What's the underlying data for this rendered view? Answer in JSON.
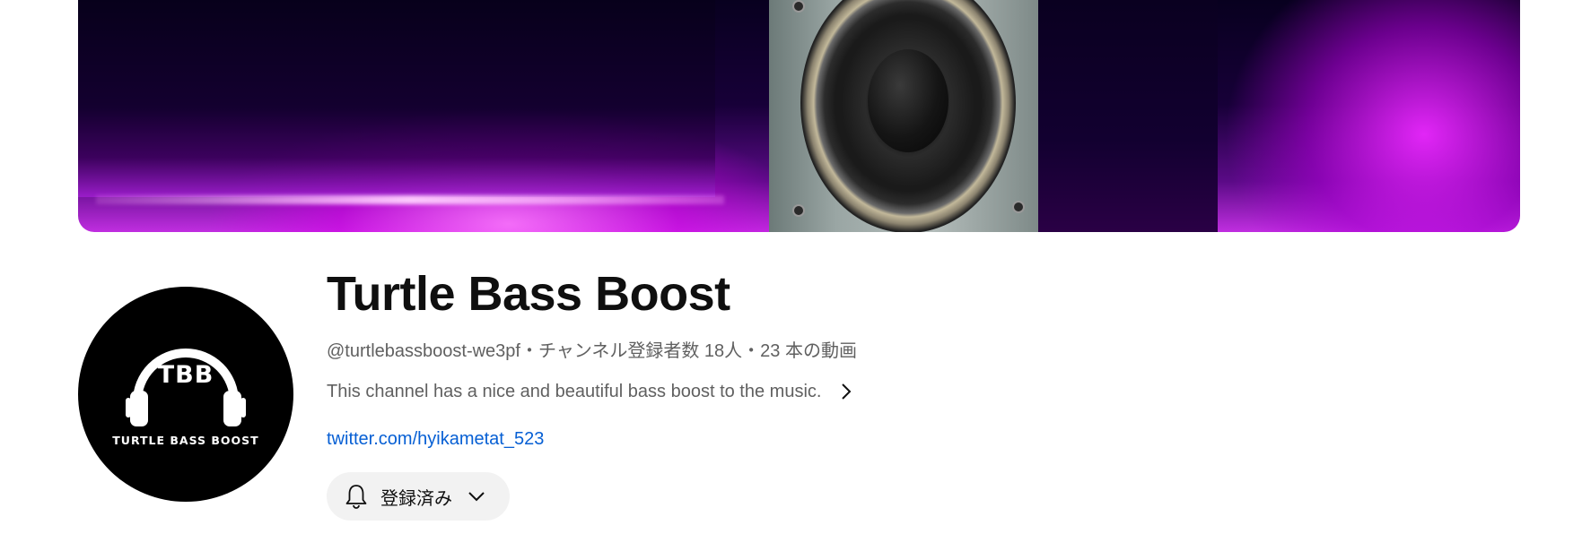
{
  "banner": {
    "description": "channel banner"
  },
  "avatar": {
    "logo_text": "TBB",
    "caption": "TURTLE BASS BOOST"
  },
  "channel": {
    "name": "Turtle Bass Boost",
    "handle": "@turtlebassboost-we3pf",
    "separator": "・",
    "subscribers": "チャンネル登録者数 18人",
    "videos": "23 本の動画",
    "description": "This channel has a nice and beautiful bass boost to the music.",
    "link": "twitter.com/hyikametat_523"
  },
  "subscribe_button": {
    "label": "登録済み"
  },
  "icons": {
    "bell": "bell-icon",
    "chevron_down": "chevron-down-icon",
    "chevron_right": "chevron-right-icon",
    "headphones": "headphones-icon"
  },
  "colors": {
    "link": "#065fd4",
    "button_bg": "#f2f2f2",
    "meta_text": "#606060",
    "title_text": "#0f0f0f"
  }
}
